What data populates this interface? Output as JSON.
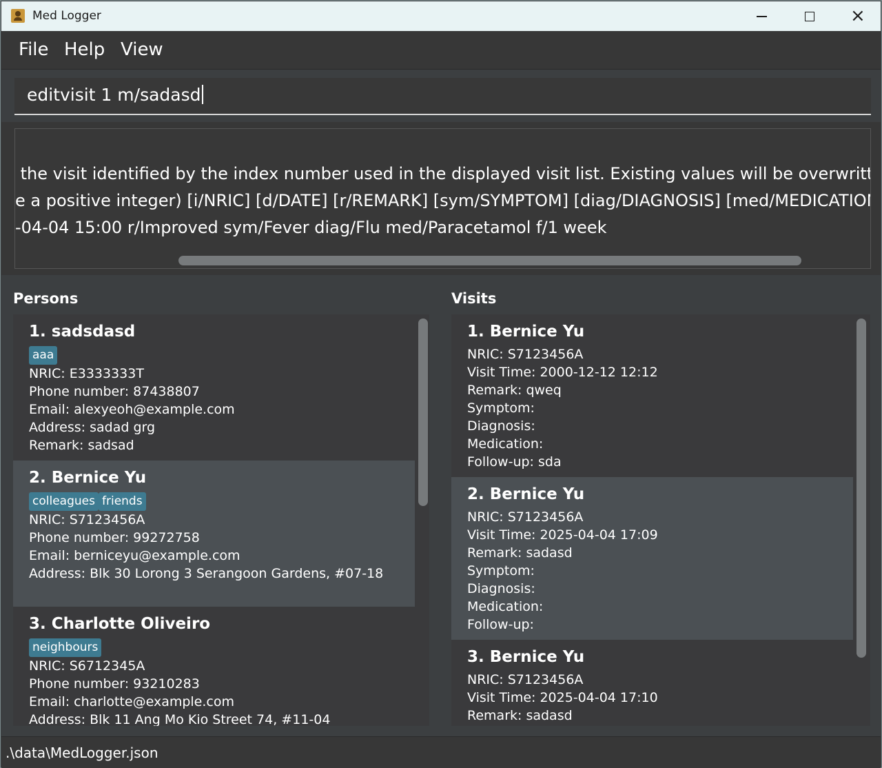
{
  "window": {
    "title": "Med Logger",
    "close_glyph": "×"
  },
  "menu": {
    "file": "File",
    "help": "Help",
    "view": "View"
  },
  "command": {
    "value": "editvisit 1 m/sadasd"
  },
  "result": {
    "lines": [
      " the visit identified by the index number used in the displayed visit list. Existing values will be overwritten by the inp",
      "e a positive integer) [i/NRIC] [d/DATE] [r/REMARK] [sym/SYMPTOM] [diag/DIAGNOSIS] [med/MEDICATION] [f/FO",
      "-04-04 15:00 r/Improved sym/Fever diag/Flu med/Paracetamol f/1 week"
    ]
  },
  "persons": {
    "label": "Persons",
    "items": [
      {
        "name": "1. sadsdasd",
        "tags": [
          "aaa"
        ],
        "nric": "NRIC: E3333333T",
        "phone": "Phone number: 87438807",
        "email": "Email: alexyeoh@example.com",
        "address": "Address: sadad grg",
        "remark": "Remark: sadsad"
      },
      {
        "name": "2. Bernice Yu",
        "tags": [
          "colleagues",
          "friends"
        ],
        "nric": "NRIC: S7123456A",
        "phone": "Phone number: 99272758",
        "email": "Email: berniceyu@example.com",
        "address": "Address: Blk 30 Lorong 3 Serangoon Gardens, #07-18",
        "remark": ""
      },
      {
        "name": "3. Charlotte Oliveiro",
        "tags": [
          "neighbours"
        ],
        "nric": "NRIC: S6712345A",
        "phone": "Phone number: 93210283",
        "email": "Email: charlotte@example.com",
        "address": "Address: Blk 11 Ang Mo Kio Street 74, #11-04",
        "remark": ""
      }
    ]
  },
  "visits": {
    "label": "Visits",
    "items": [
      {
        "name": "1. Bernice Yu",
        "nric": "NRIC: S7123456A",
        "time": "Visit Time: 2000-12-12 12:12",
        "remark": "Remark: qweq",
        "symptom": "Symptom:",
        "diagnosis": "Diagnosis:",
        "medication": "Medication:",
        "followup": "Follow-up: sda"
      },
      {
        "name": "2. Bernice Yu",
        "nric": "NRIC: S7123456A",
        "time": "Visit Time: 2025-04-04 17:09",
        "remark": "Remark: sadasd",
        "symptom": "Symptom:",
        "diagnosis": "Diagnosis:",
        "medication": "Medication:",
        "followup": "Follow-up:"
      },
      {
        "name": "3. Bernice Yu",
        "nric": "NRIC: S7123456A",
        "time": "Visit Time: 2025-04-04 17:10",
        "remark": "Remark: sadasd"
      }
    ]
  },
  "status": {
    "path": ".\\data\\MedLogger.json"
  },
  "colors": {
    "background": "#3c3f41",
    "card_selected": "#4b5054",
    "tag": "#3e7b91",
    "titlebar": "#e8f3f4"
  },
  "icons": [
    "app-icon",
    "minimize-icon",
    "maximize-icon",
    "close-icon"
  ]
}
